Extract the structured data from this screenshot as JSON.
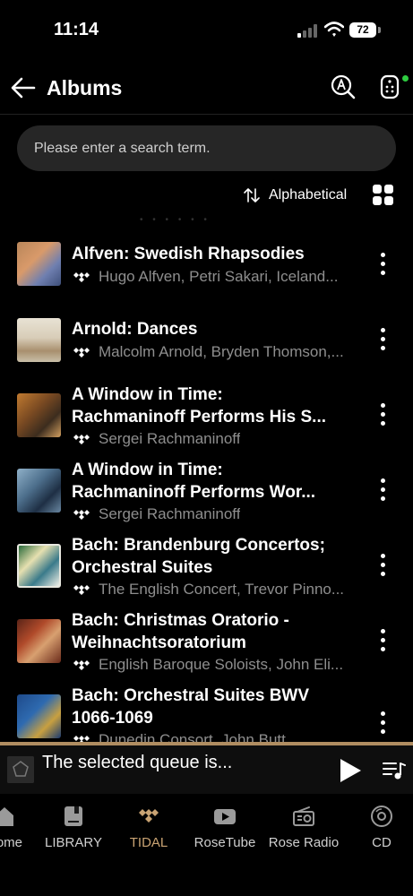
{
  "status": {
    "time": "11:14",
    "battery": "72"
  },
  "header": {
    "title": "Albums"
  },
  "search": {
    "placeholder": "Please enter a search term."
  },
  "sort": {
    "label": "Alphabetical"
  },
  "albums": [
    {
      "title": "Alfven: Swedish Rhapsodies",
      "artist": "Hugo Alfven, Petri Sakari, Iceland..."
    },
    {
      "title": "Arnold: Dances",
      "artist": "Malcolm Arnold, Bryden Thomson,..."
    },
    {
      "title": "A Window in Time:\nRachmaninoff Performs His S...",
      "artist": "Sergei Rachmaninoff"
    },
    {
      "title": "A Window in Time:\nRachmaninoff Performs Wor...",
      "artist": "Sergei Rachmaninoff"
    },
    {
      "title": "Bach: Brandenburg Concertos;\nOrchestral Suites",
      "artist": "The English Concert, Trevor Pinno..."
    },
    {
      "title": "Bach: Christmas Oratorio -\nWeihnachtsoratorium",
      "artist": "English Baroque Soloists, John Eli..."
    },
    {
      "title": "Bach: Orchestral Suites BWV\n1066-1069",
      "artist": "Dunedin Consort, John Butt"
    }
  ],
  "player": {
    "title": "The selected queue is..."
  },
  "tabs": [
    {
      "label": "Home",
      "icon": "home-icon"
    },
    {
      "label": "LIBRARY",
      "icon": "library-icon"
    },
    {
      "label": "TIDAL",
      "icon": "tidal-icon"
    },
    {
      "label": "RoseTube",
      "icon": "play-video-icon"
    },
    {
      "label": "Rose Radio",
      "icon": "radio-icon"
    },
    {
      "label": "CD",
      "icon": "cd-icon"
    }
  ],
  "colors": {
    "accent": "#c9a373",
    "player_border": "#b08d61",
    "status_dot": "#2ecc40",
    "search_bg": "#262626"
  }
}
